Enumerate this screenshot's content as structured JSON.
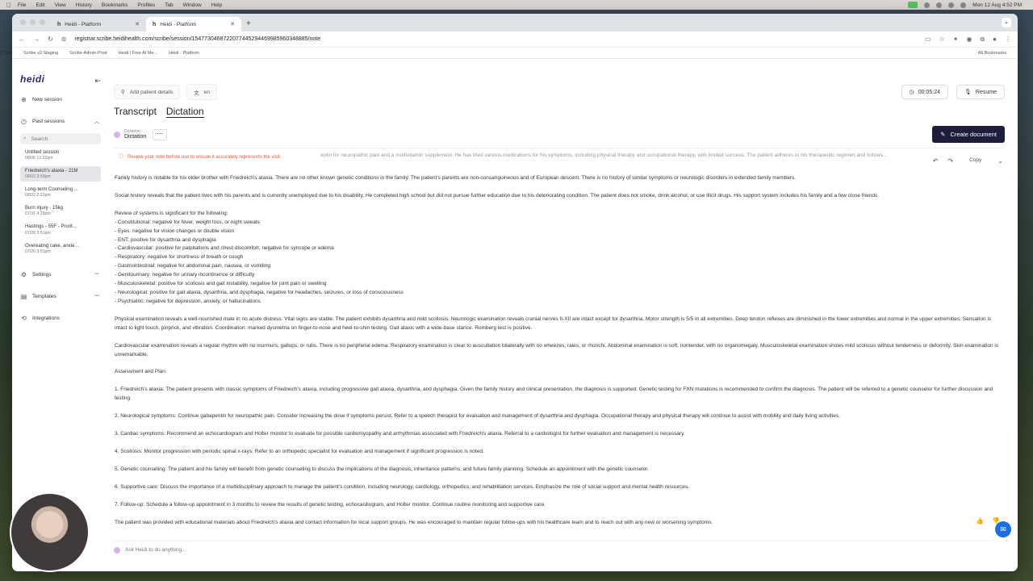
{
  "menubar": {
    "app": "Chrome",
    "items": [
      "File",
      "Edit",
      "View",
      "History",
      "Bookmarks",
      "Profiles",
      "Tab",
      "Window",
      "Help"
    ],
    "clock": "Mon 12 Aug 4:52 PM"
  },
  "browser": {
    "tabs": [
      {
        "title": "Heidi - Platform",
        "favicon": "h"
      },
      {
        "title": "Heidi - Platform",
        "favicon": "h"
      }
    ],
    "url": "registrar.scribe.heidihealth.com/scribe/session/154773046872207744529446998596034888​5/note",
    "bookmarks": [
      "Scribe v2 Staging",
      "Scribe-Admin-Prod",
      "Heidi | Free AI Me...",
      "Heidi - Platform"
    ],
    "all_bookmarks": "All Bookmarks"
  },
  "sidebar": {
    "logo": "heidi",
    "new_session": "New session",
    "past_sessions": "Past sessions",
    "search_placeholder": "Search",
    "sessions": [
      {
        "title": "Untitled session",
        "date": "08/06 12:32pm"
      },
      {
        "title": "Friedreich's ataxia - 21M",
        "date": "08/02 3:53pm"
      },
      {
        "title": "Long-term Counseling ...",
        "date": "08/02 2:22pm"
      },
      {
        "title": "Burn injury - 15kg",
        "date": "07/31 4:29pm"
      },
      {
        "title": "Hastings - 55F - Prurit...",
        "date": "07/26 3:51pm"
      },
      {
        "title": "Overeating cake, anxie...",
        "date": "07/26 3:51pm"
      }
    ],
    "settings": "Settings",
    "templates": "Templates",
    "integrations": "Integrations"
  },
  "header": {
    "add_patient": "Add patient details",
    "language": "en",
    "timer": "00:05:24",
    "resume": "Resume"
  },
  "tabs": {
    "transcript": "Transcript",
    "dictation": "Dictation"
  },
  "docbar": {
    "label_small": "Dictation:",
    "label": "Dictation",
    "create": "Create document",
    "copy": "Copy"
  },
  "note": {
    "warning": "Review your note before use to ensure it accurately represents the visit.",
    "partial_top": "entin for neuropathic pain and a multivitamin supplement. He has tried various medications for his symptoms, including physical therapy and occupational therapy, with limited success. The patient adheres to his therapeutic regimen and follows...",
    "p1": "Family history is notable for his older brother with Friedreich's ataxia. There are no other known genetic conditions in the family. The patient's parents are non-consanguineous and of European descent. There is no history of similar symptoms or neurologic disorders in extended family members.",
    "p2": "Social history reveals that the patient lives with his parents and is currently unemployed due to his disability. He completed high school but did not pursue further education due to his deteriorating condition. The patient does not smoke, drink alcohol, or use illicit drugs. His support system includes his family and a few close friends.",
    "ros_title": "Review of systems is significant for the following:",
    "ros": [
      "- Constitutional: negative for fever, weight loss, or night sweats",
      "- Eyes: negative for vision changes or double vision",
      "- ENT: positive for dysarthria and dysphagia",
      "- Cardiovascular: positive for palpitations and chest discomfort, negative for syncope or edema",
      "- Respiratory: negative for shortness of breath or cough",
      "- Gastrointestinal: negative for abdominal pain, nausea, or vomiting",
      "- Genitourinary: negative for urinary incontinence or difficulty",
      "- Musculoskeletal: positive for scoliosis and gait instability, negative for joint pain or swelling",
      "- Neurological: positive for gait ataxia, dysarthria, and dysphagia, negative for headaches, seizures, or loss of consciousness",
      "- Psychiatric: negative for depression, anxiety, or hallucinations"
    ],
    "p3": "Physical examination reveals a well-nourished male in no acute distress. Vital signs are stable. The patient exhibits dysarthria and mild scoliosis. Neurologic examination reveals cranial nerves II-XII are intact except for dysarthria. Motor strength is 5/5 in all extremities. Deep tendon reflexes are diminished in the lower extremities and normal in the upper extremities. Sensation is intact to light touch, pinprick, and vibration. Coordination: marked dysmetria on finger-to-nose and heel-to-shin testing. Gait ataxic with a wide-base stance. Romberg test is positive.",
    "p4": "Cardiovascular examination reveals a regular rhythm with no murmurs, gallops, or rubs. There is no peripheral edema. Respiratory examination is clear to auscultation bilaterally with no wheezes, rales, or rhonchi. Abdominal examination is soft, nontender, with no organomegaly. Musculoskeletal examination shows mild scoliosis without tenderness or deformity. Skin examination is unremarkable.",
    "ap_title": "Assessment and Plan:",
    "ap": [
      "1. Friedreich's ataxia: The patient presents with classic symptoms of Friedreich's ataxia, including progressive gait ataxia, dysarthria, and dysphagia. Given the family history and clinical presentation, the diagnosis is supported. Genetic testing for FXN mutations is recommended to confirm the diagnosis. The patient will be referred to a genetic counselor for further discussion and testing.",
      "2. Neurological symptoms: Continue gabapentin for neuropathic pain. Consider increasing the dose if symptoms persist. Refer to a speech therapist for evaluation and management of dysarthria and dysphagia. Occupational therapy and physical therapy will continue to assist with mobility and daily living activities.",
      "3. Cardiac symptoms: Recommend an echocardiogram and Holter monitor to evaluate for possible cardiomyopathy and arrhythmias associated with Friedreich's ataxia. Referral to a cardiologist for further evaluation and management is necessary.",
      "4. Scoliosis: Monitor progression with periodic spinal x-rays. Refer to an orthopedic specialist for evaluation and management if significant progression is noted.",
      "5. Genetic counseling: The patient and his family will benefit from genetic counseling to discuss the implications of the diagnosis, inheritance patterns, and future family planning. Schedule an appointment with the genetic counselor.",
      "6. Supportive care: Discuss the importance of a multidisciplinary approach to manage the patient's condition, including neurology, cardiology, orthopedics, and rehabilitation services. Emphasize the role of social support and mental health resources.",
      "7. Follow-up: Schedule a follow-up appointment in 3 months to review the results of genetic testing, echocardiogram, and Holter monitor. Continue routine monitoring and supportive care."
    ],
    "p_last": "The patient was provided with educational materials about Friedreich's ataxia and contact information for local support groups. He was encouraged to maintain regular follow-ups with his healthcare team and to reach out with any new or worsening symptoms."
  },
  "ask_placeholder": "Ask Heidi to do anything..."
}
